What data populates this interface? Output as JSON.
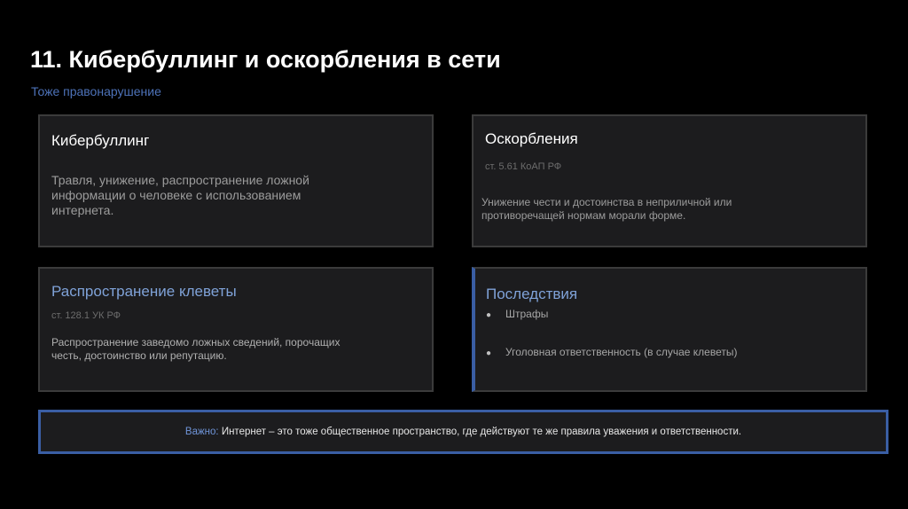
{
  "slide": {
    "title": "11. Кибербуллинг и оскорбления в сети",
    "subtitle": "Тоже правонарушение"
  },
  "cards": {
    "cyberbullying": {
      "title": "Кибербуллинг",
      "description": "Травля, унижение, распространение ложной информации о человеке с использованием интернета."
    },
    "insults": {
      "title": "Оскорбления",
      "reference": "ст. 5.61 КоАП РФ",
      "description": "Унижение чести и достоинства в неприличной или противоречащей нормам морали форме."
    },
    "slander": {
      "title": "Распространение клеветы",
      "reference": "ст. 128.1 УК РФ",
      "description": "Распространение заведомо ложных сведений, порочащих честь, достоинство или репутацию."
    },
    "consequences": {
      "title": "Последствия",
      "items": [
        "Штрафы",
        "Уголовная ответственность (в случае клеветы)"
      ]
    }
  },
  "important": {
    "label": "Важно:",
    "text": "Интернет – это тоже общественное пространство, где действуют те же правила уважения и ответственности."
  },
  "colors": {
    "background": "#000000",
    "card": "#1c1c1e",
    "accent": "#3a5ea4",
    "accent_text": "#7fa2d8"
  }
}
